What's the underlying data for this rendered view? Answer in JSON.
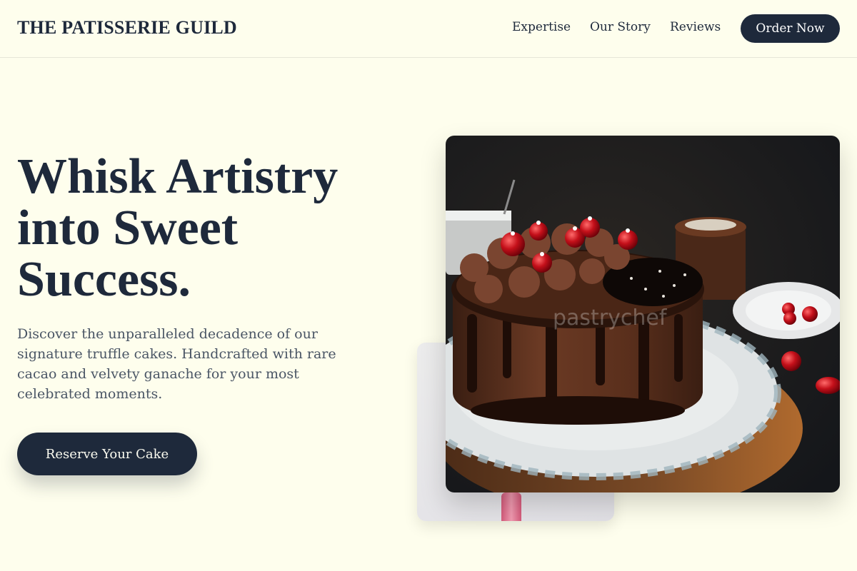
{
  "header": {
    "brand": "THE PATISSERIE GUILD",
    "nav": [
      {
        "label": "Expertise"
      },
      {
        "label": "Our Story"
      },
      {
        "label": "Reviews"
      }
    ],
    "cta_label": "Order Now"
  },
  "hero": {
    "headline_lines": [
      "Whisk Artistry",
      "into Sweet",
      "Success."
    ],
    "description": "Discover the unparalleled decadence of our signature truffle cakes. Handcrafted with rare cacao and velvety ganache for your most celebrated moments.",
    "button_label": "Reserve Your Cake",
    "photo_watermark": "pastrychef"
  },
  "colors": {
    "background": "#fefeed",
    "primary": "#1e293b",
    "body_text": "#4a5565"
  }
}
